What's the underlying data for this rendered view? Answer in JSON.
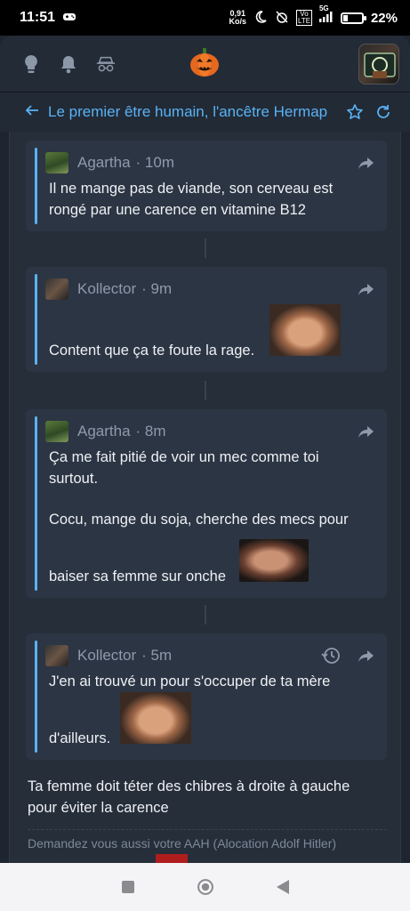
{
  "status_bar": {
    "time": "11:51",
    "net_speed_value": "0,91",
    "net_speed_unit": "Ko/s",
    "network_type": "5G",
    "volte": "Vo LTE",
    "battery_level": 0.22,
    "battery_text": "22%"
  },
  "header": {
    "icons": [
      "lightbulb-icon",
      "bell-icon",
      "incognito-icon",
      "pumpkin-icon",
      "avatar"
    ]
  },
  "topic": {
    "title": "Le premier être humain, l'ancêtre Hermap"
  },
  "quotes": [
    {
      "author": "Agartha",
      "time": "· 10m",
      "lines": [
        "Il ne mange pas de viande, son cerveau est",
        "rongé par une carence en vitamine B12"
      ]
    },
    {
      "author": "Kollector",
      "time": "· 9m",
      "lines": [
        "Content que ça te foute la rage."
      ]
    },
    {
      "author": "Agartha",
      "time": "· 8m",
      "lines": [
        "Ça me fait pitié de voir un mec comme toi",
        "surtout.",
        "Cocu, mange du soja, cherche des mecs pour",
        "baiser sa femme sur onche"
      ]
    },
    {
      "author": "Kollector",
      "time": "· 5m",
      "lines": [
        "J'en ai trouvé un pour s'occuper de ta mère",
        "d'ailleurs."
      ]
    }
  ],
  "reply": {
    "lines": [
      "Ta femme doit téter des chibres à droite à gauche",
      "pour éviter la carence"
    ]
  },
  "signature": {
    "text": "Demandez vous aussi votre AAH (Alocation Adolf Hitler)"
  },
  "colors": {
    "accent": "#5ab2f5",
    "background": "#1f2530",
    "card": "#2c3543"
  }
}
